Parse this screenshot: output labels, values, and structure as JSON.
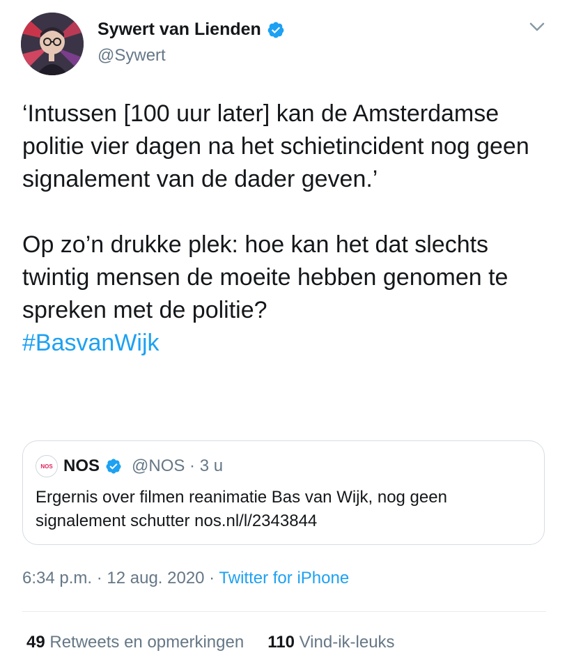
{
  "author": {
    "name": "Sywert van Lienden",
    "handle": "@Sywert",
    "verified": true
  },
  "tweet": {
    "paragraph1": "‘Intussen [100 uur later] kan de Amsterdamse politie vier dagen na het schietincident nog geen signalement van de dader geven.’",
    "paragraph2": "Op zo’n drukke plek: hoe kan het dat slechts twintig mensen de moeite hebben genomen te spreken met de politie?",
    "hashtag": "#BasvanWijk"
  },
  "quoted_tweet": {
    "logo_text": "NOS",
    "name": "NOS",
    "verified": true,
    "meta": "@NOS · 3 u",
    "text": "Ergernis over filmen reanimatie Bas van Wijk, nog geen signalement schutter nos.nl/l/2343844"
  },
  "timestamp": {
    "time_date": "6:34 p.m. · 12 aug. 2020 · ",
    "source": "Twitter for iPhone"
  },
  "stats": {
    "retweets_count": "49",
    "retweets_label": "Retweets en opmerkingen",
    "likes_count": "110",
    "likes_label": "Vind-ik-leuks"
  },
  "colors": {
    "link": "#1da1f2",
    "secondary_text": "#657786",
    "verified_badge": "#1da1f2"
  },
  "icons": [
    "avatar",
    "verified-badge-icon",
    "chevron-down-icon",
    "nos-logo"
  ]
}
